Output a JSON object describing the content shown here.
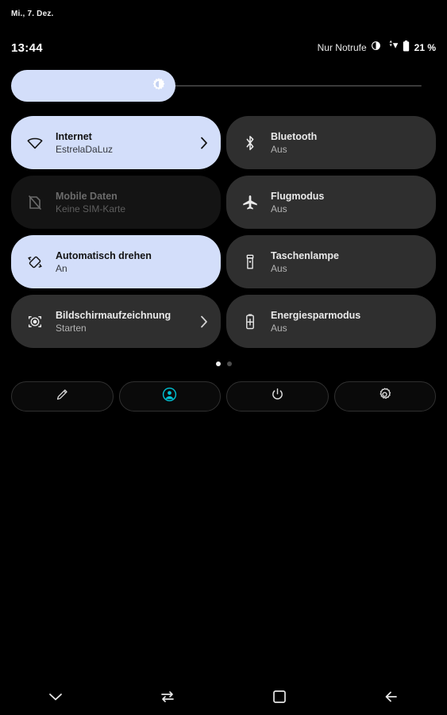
{
  "status": {
    "date": "Mi., 7. Dez.",
    "clock": "13:44",
    "carrier": "Nur Notrufe",
    "battery_percent": "21 %",
    "icons": [
      "dnd-icon",
      "wifi-icon",
      "battery-icon"
    ]
  },
  "brightness": {
    "icon": "brightness-icon",
    "level_percent": 40
  },
  "tiles": [
    {
      "title": "Internet",
      "subtitle": "EstrelaDaLuz",
      "icon": "wifi-icon",
      "state": "active",
      "has_chevron": true
    },
    {
      "title": "Bluetooth",
      "subtitle": "Aus",
      "icon": "bluetooth-icon",
      "state": "inactive",
      "has_chevron": false
    },
    {
      "title": "Mobile Daten",
      "subtitle": "Keine SIM-Karte",
      "icon": "sim-off-icon",
      "state": "disabled",
      "has_chevron": false
    },
    {
      "title": "Flugmodus",
      "subtitle": "Aus",
      "icon": "airplane-icon",
      "state": "inactive",
      "has_chevron": false
    },
    {
      "title": "Automatisch drehen",
      "subtitle": "An",
      "icon": "auto-rotate-icon",
      "state": "active",
      "has_chevron": false
    },
    {
      "title": "Taschenlampe",
      "subtitle": "Aus",
      "icon": "flashlight-icon",
      "state": "inactive",
      "has_chevron": false
    },
    {
      "title": "Bildschirmaufzeichnung",
      "subtitle": "Starten",
      "icon": "screen-record-icon",
      "state": "inactive",
      "has_chevron": true
    },
    {
      "title": "Energiesparmodus",
      "subtitle": "Aus",
      "icon": "battery-saver-icon",
      "state": "inactive",
      "has_chevron": false
    }
  ],
  "pages": {
    "count": 2,
    "current": 1
  },
  "footer_actions": [
    {
      "icon": "pencil-icon",
      "name": "edit-tiles-button"
    },
    {
      "icon": "user-avatar-icon",
      "name": "user-switch-button"
    },
    {
      "icon": "power-icon",
      "name": "power-button"
    },
    {
      "icon": "gear-icon",
      "name": "settings-button"
    }
  ],
  "nav_bar": [
    {
      "icon": "chevron-down-icon",
      "name": "collapse-button"
    },
    {
      "icon": "switch-icon",
      "name": "switch-apps-button"
    },
    {
      "icon": "home-square-icon",
      "name": "home-button"
    },
    {
      "icon": "back-arrow-icon",
      "name": "back-button"
    }
  ],
  "colors": {
    "active_tile": "#d3defa",
    "inactive_tile": "#2f2f2f",
    "disabled_tile": "#141414",
    "accent_cyan": "#00c2d4",
    "background": "#000000"
  }
}
